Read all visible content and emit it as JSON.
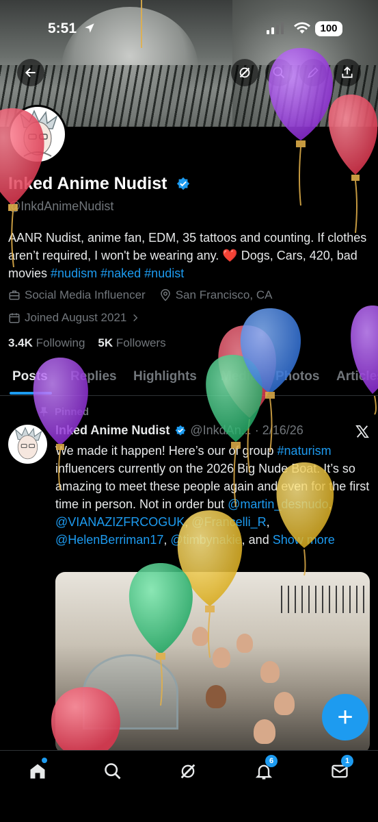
{
  "status_bar": {
    "time": "5:51",
    "battery": "100"
  },
  "profile": {
    "name": "Inked Anime Nudist",
    "handle": "@InkdAnimeNudist",
    "bio_text": "AANR Nudist, anime fan, EDM, 35 tattoos and counting. If clothes aren’t required, I won't be wearing any. ❤️ Dogs, Cars, 420, bad movies",
    "bio_hashtags": [
      "#nudism",
      "#naked",
      "#nudist"
    ],
    "category": "Social Media Influencer",
    "location": "San Francisco, CA",
    "joined": "Joined August 2021",
    "following_count": "3.4K",
    "following_label": "Following",
    "followers_count": "5K",
    "followers_label": "Followers"
  },
  "tabs": [
    "Posts",
    "Replies",
    "Highlights",
    "Media",
    "Photos",
    "Articles"
  ],
  "post": {
    "pinned_label": "Pinned",
    "author": "Inked Anime Nudist",
    "handle": "@InkdAn...",
    "date": "· 2/16/26",
    "text_1": "We made it happen! Here’s our of group ",
    "hashtag": "#naturism",
    "text_2": " influencers currently on the 2026 Big Nude Boat. It’s so amazing to meet these people again and even for the first time in person. Not in order but ",
    "mention_1": "@martin_desnudo",
    "mention_2": "@VIANAZIZFRCOGUK",
    "mention_3": "@Francelli_R",
    "mention_4": "@HelenBerriman17",
    "mention_5": "@timbynakie",
    "sep": ", ",
    "and": ", and ",
    "show_more": "Show more"
  },
  "nav": {
    "notifications_badge": "6",
    "messages_badge": "1"
  },
  "balloon_colors": {
    "red": "#e84a5f",
    "purple": "#9b3fd9",
    "green": "#35c27a",
    "blue": "#3f7fe0",
    "yellow": "#e8c43a"
  }
}
